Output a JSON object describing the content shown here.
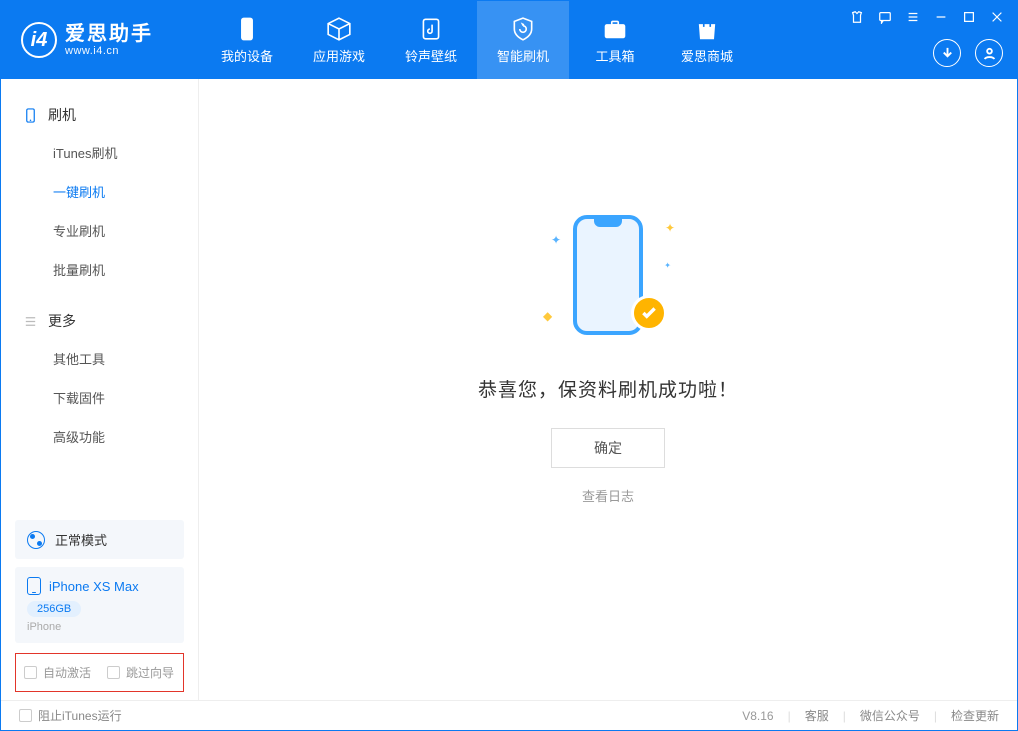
{
  "app": {
    "title": "爱思助手",
    "subtitle": "www.i4.cn"
  },
  "nav": {
    "my_device": "我的设备",
    "apps_games": "应用游戏",
    "ringtones": "铃声壁纸",
    "flash": "智能刷机",
    "toolbox": "工具箱",
    "store": "爱思商城"
  },
  "sidebar": {
    "group1": "刷机",
    "items1": {
      "itunes": "iTunes刷机",
      "onekey": "一键刷机",
      "pro": "专业刷机",
      "batch": "批量刷机"
    },
    "group2": "更多",
    "items2": {
      "other": "其他工具",
      "firmware": "下载固件",
      "advanced": "高级功能"
    }
  },
  "device": {
    "mode": "正常模式",
    "name": "iPhone XS Max",
    "storage": "256GB",
    "type": "iPhone"
  },
  "bottom_checks": {
    "auto_activate": "自动激活",
    "skip_guide": "跳过向导"
  },
  "main": {
    "success_text": "恭喜您，保资料刷机成功啦！",
    "confirm": "确定",
    "view_log": "查看日志"
  },
  "footer": {
    "block_itunes": "阻止iTunes运行",
    "version": "V8.16",
    "support": "客服",
    "wechat": "微信公众号",
    "check_update": "检查更新"
  }
}
